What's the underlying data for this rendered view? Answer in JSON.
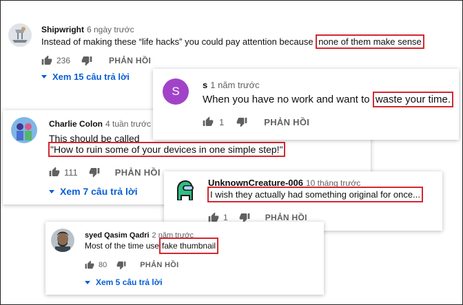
{
  "comments": [
    {
      "author": "Shipwright",
      "time": "6 ngày trước",
      "text_before": "Instead of making these “life hacks” you could pay attention because",
      "text_highlight": "none of them make sense",
      "likes": "236",
      "reply_label": "PHẢN HỒI",
      "view_replies": "Xem 15 câu trả lời"
    },
    {
      "author": "s",
      "avatar_letter": "S",
      "avatar_color": "#a143c9",
      "time": "1 năm trước",
      "text_before": "When you have no work and want to",
      "text_highlight": "waste your time.",
      "likes": "1",
      "reply_label": "PHẢN HỒI"
    },
    {
      "author": "Charlie Colon",
      "time": "4 tuần trước",
      "text_line1": "This should be called",
      "text_highlight": "\"How to ruin some of your devices in one simple step!\"",
      "likes": "111",
      "reply_label": "PHẢN HỒI",
      "view_replies": "Xem 7 câu trả lời"
    },
    {
      "author": "UnknownCreature-006",
      "time": "10 tháng trước",
      "text_highlight": "I wish they actually had something original for once...",
      "likes": "1",
      "reply_label": "PHẢN HỒI"
    },
    {
      "author": "syed Qasim Qadri",
      "time": "2 năm trước",
      "text_before": "Most of the time use",
      "text_highlight": "fake thumbnail",
      "likes": "80",
      "reply_label": "PHẢN HỒI",
      "view_replies": "Xem 5 câu trả lời"
    }
  ],
  "colors": {
    "highlight_border": "#d6262e",
    "link": "#065fd4",
    "muted": "#606060"
  },
  "icons": [
    "thumb-up-icon",
    "thumb-down-icon",
    "caret-down-icon"
  ]
}
